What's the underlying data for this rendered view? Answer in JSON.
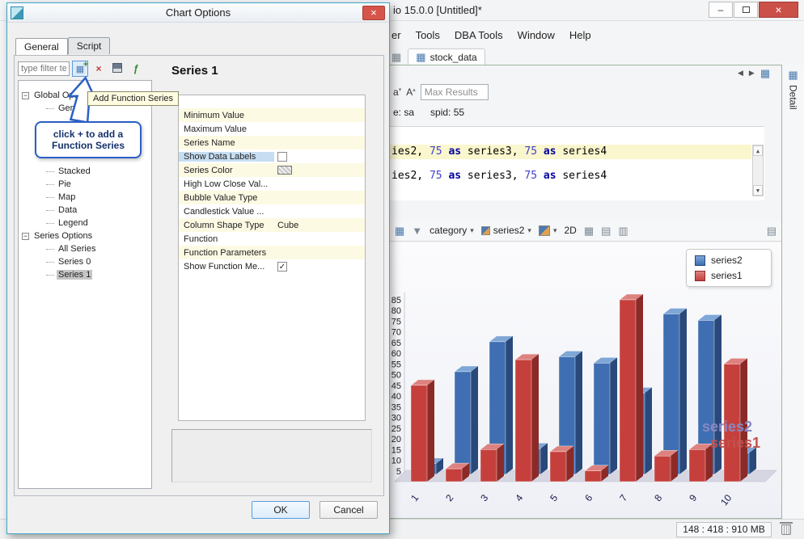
{
  "dialog": {
    "title": "Chart Options",
    "tabs": [
      {
        "label": "General"
      },
      {
        "label": "Script"
      }
    ],
    "filter_text": "type filter te",
    "tooltip_text": "Add Function Series",
    "callout_line1": "click + to add a",
    "callout_line2": "Function Series",
    "tree": [
      {
        "label": "Global Options",
        "level": 0,
        "expander": true
      },
      {
        "label": "General",
        "level": 1
      },
      {
        "spacer": true
      },
      {
        "label": "Stacked",
        "level": 1
      },
      {
        "label": "Pie",
        "level": 1
      },
      {
        "label": "Map",
        "level": 1
      },
      {
        "label": "Data",
        "level": 1
      },
      {
        "label": "Legend",
        "level": 1
      },
      {
        "label": "Series Options",
        "level": 0,
        "expander": true
      },
      {
        "label": "All Series",
        "level": 1
      },
      {
        "label": "Series 0",
        "level": 1
      },
      {
        "label": "Series 1",
        "level": 1,
        "selected": true
      }
    ],
    "panel_title": "Series 1",
    "properties": [
      {
        "name": "Minimum Value"
      },
      {
        "name": "Maximum Value"
      },
      {
        "name": "Series Name"
      },
      {
        "name": "Show Data Labels",
        "control": "checkbox",
        "checked": false,
        "selected": true
      },
      {
        "name": "Series Color",
        "control": "swatch"
      },
      {
        "name": "High Low Close Val..."
      },
      {
        "name": "Bubble Value Type"
      },
      {
        "name": "Candlestick Value ..."
      },
      {
        "name": "Column Shape Type",
        "value": "Cube"
      },
      {
        "name": "Function"
      },
      {
        "name": "Function Parameters"
      },
      {
        "name": "Show Function Me...",
        "control": "checkbox",
        "checked": true
      }
    ],
    "ok_label": "OK",
    "cancel_label": "Cancel"
  },
  "window": {
    "title": "io 15.0.0 [Untitled]*",
    "menus": [
      "er",
      "Tools",
      "DBA Tools",
      "Window",
      "Help"
    ],
    "document_tab": "stock_data",
    "max_results_placeholder": "Max Results",
    "session_fragment_1": "e: sa",
    "session_fragment_2": "spid: 55",
    "detail_label": "Detail",
    "sql_tokens": [
      {
        "t": "ies2, ",
        "c": "plain"
      },
      {
        "t": "75",
        "c": "num"
      },
      {
        "t": " ",
        "c": "plain"
      },
      {
        "t": "as",
        "c": "kw"
      },
      {
        "t": " series3, ",
        "c": "plain"
      },
      {
        "t": "75",
        "c": "num"
      },
      {
        "t": " ",
        "c": "plain"
      },
      {
        "t": "as",
        "c": "kw"
      },
      {
        "t": " series4",
        "c": "plain"
      }
    ],
    "chart_toolbar": {
      "category_label": "category",
      "series_label": "series2",
      "mode_label": "2D"
    },
    "status_text": "148 : 418 : 910 MB"
  },
  "chart_data": {
    "type": "bar",
    "variant": "3d-column",
    "title": "",
    "categories": [
      "1",
      "2",
      "3",
      "4",
      "5",
      "6",
      "7",
      "8",
      "9",
      "10"
    ],
    "series": [
      {
        "name": "series2",
        "color": "#3f6fb2",
        "values": [
          5,
          48,
          62,
          12,
          55,
          52,
          38,
          75,
          72,
          10
        ]
      },
      {
        "name": "series1",
        "color": "#c5403c",
        "values": [
          45,
          6,
          15,
          57,
          14,
          5,
          85,
          12,
          15,
          55
        ]
      }
    ],
    "ylim": [
      0,
      85
    ],
    "ytick_step": 5,
    "grid": false,
    "legend_position": "top-right"
  }
}
